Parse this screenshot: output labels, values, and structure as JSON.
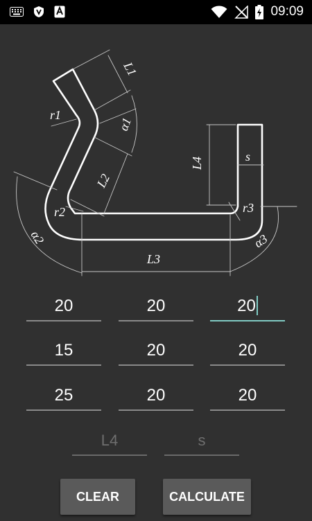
{
  "status_bar": {
    "time": "09:09",
    "icons": [
      "keyboard-icon",
      "shield-icon",
      "a-icon",
      "wifi-icon",
      "no-signal-icon",
      "battery-charging-icon"
    ]
  },
  "diagram": {
    "labels": {
      "l1": "L1",
      "r1": "r1",
      "alpha1": "α1",
      "l2": "L2",
      "r2": "r2",
      "alpha2": "α2",
      "l3": "L3",
      "l4": "L4",
      "s": "s",
      "r3": "r3",
      "alpha3": "α3"
    }
  },
  "inputs": {
    "rows": [
      [
        "20",
        "20",
        "20"
      ],
      [
        "15",
        "20",
        "20"
      ],
      [
        "25",
        "20",
        "20"
      ]
    ],
    "l4_placeholder": "L4",
    "s_placeholder": "s"
  },
  "buttons": {
    "clear": "CLEAR",
    "calculate": "CALCULATE"
  },
  "colors": {
    "background": "#303030",
    "accent": "#80cbc4",
    "button": "#5a5a5a"
  }
}
